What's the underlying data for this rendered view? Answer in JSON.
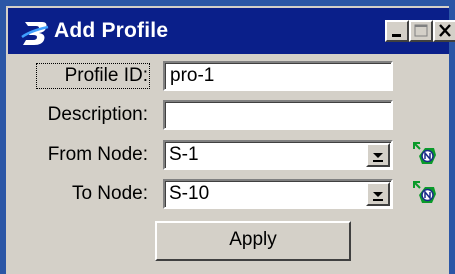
{
  "window": {
    "title": "Add Profile",
    "titlebar_color": "#0a1f8a",
    "icon": "bentley-b-logo",
    "controls": [
      "minimize-icon",
      "maximize-icon",
      "close-icon"
    ]
  },
  "form": {
    "profile_id_label": "Profile ID:",
    "profile_id_value": "pro-1",
    "description_label": "Description:",
    "description_value": "",
    "from_node_label": "From Node:",
    "from_node_value": "S-1",
    "to_node_label": "To Node:",
    "to_node_value": "S-10",
    "pick_icon": "node-pick-icon",
    "apply_label": "Apply"
  }
}
